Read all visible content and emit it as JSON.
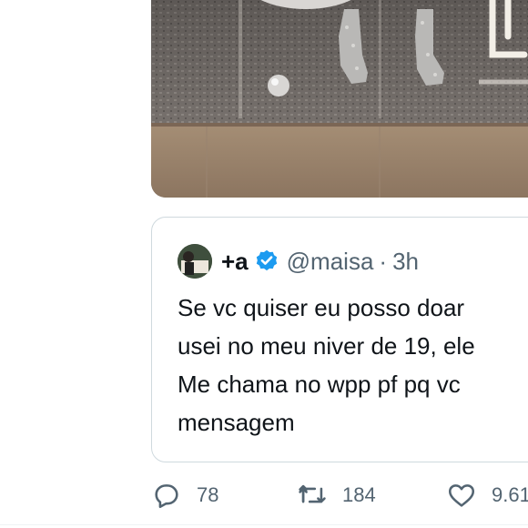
{
  "quote": {
    "display_name": "+a",
    "handle": "@maisa",
    "separator": "·",
    "time": "3h",
    "text_lines": [
      "Se vc quiser eu posso doar",
      "usei no meu niver de 19, ele",
      "Me chama no wpp pf pq vc",
      "mensagem"
    ]
  },
  "actions": {
    "reply_count": "78",
    "retweet_count": "184",
    "like_count": "9.61"
  },
  "icons": {
    "reply": "reply-icon",
    "retweet": "retweet-icon",
    "like": "heart-icon",
    "verified": "verified-badge-icon"
  },
  "colors": {
    "verified_blue": "#1d9bf0",
    "secondary_text": "#536471",
    "border": "#cfd9de"
  }
}
